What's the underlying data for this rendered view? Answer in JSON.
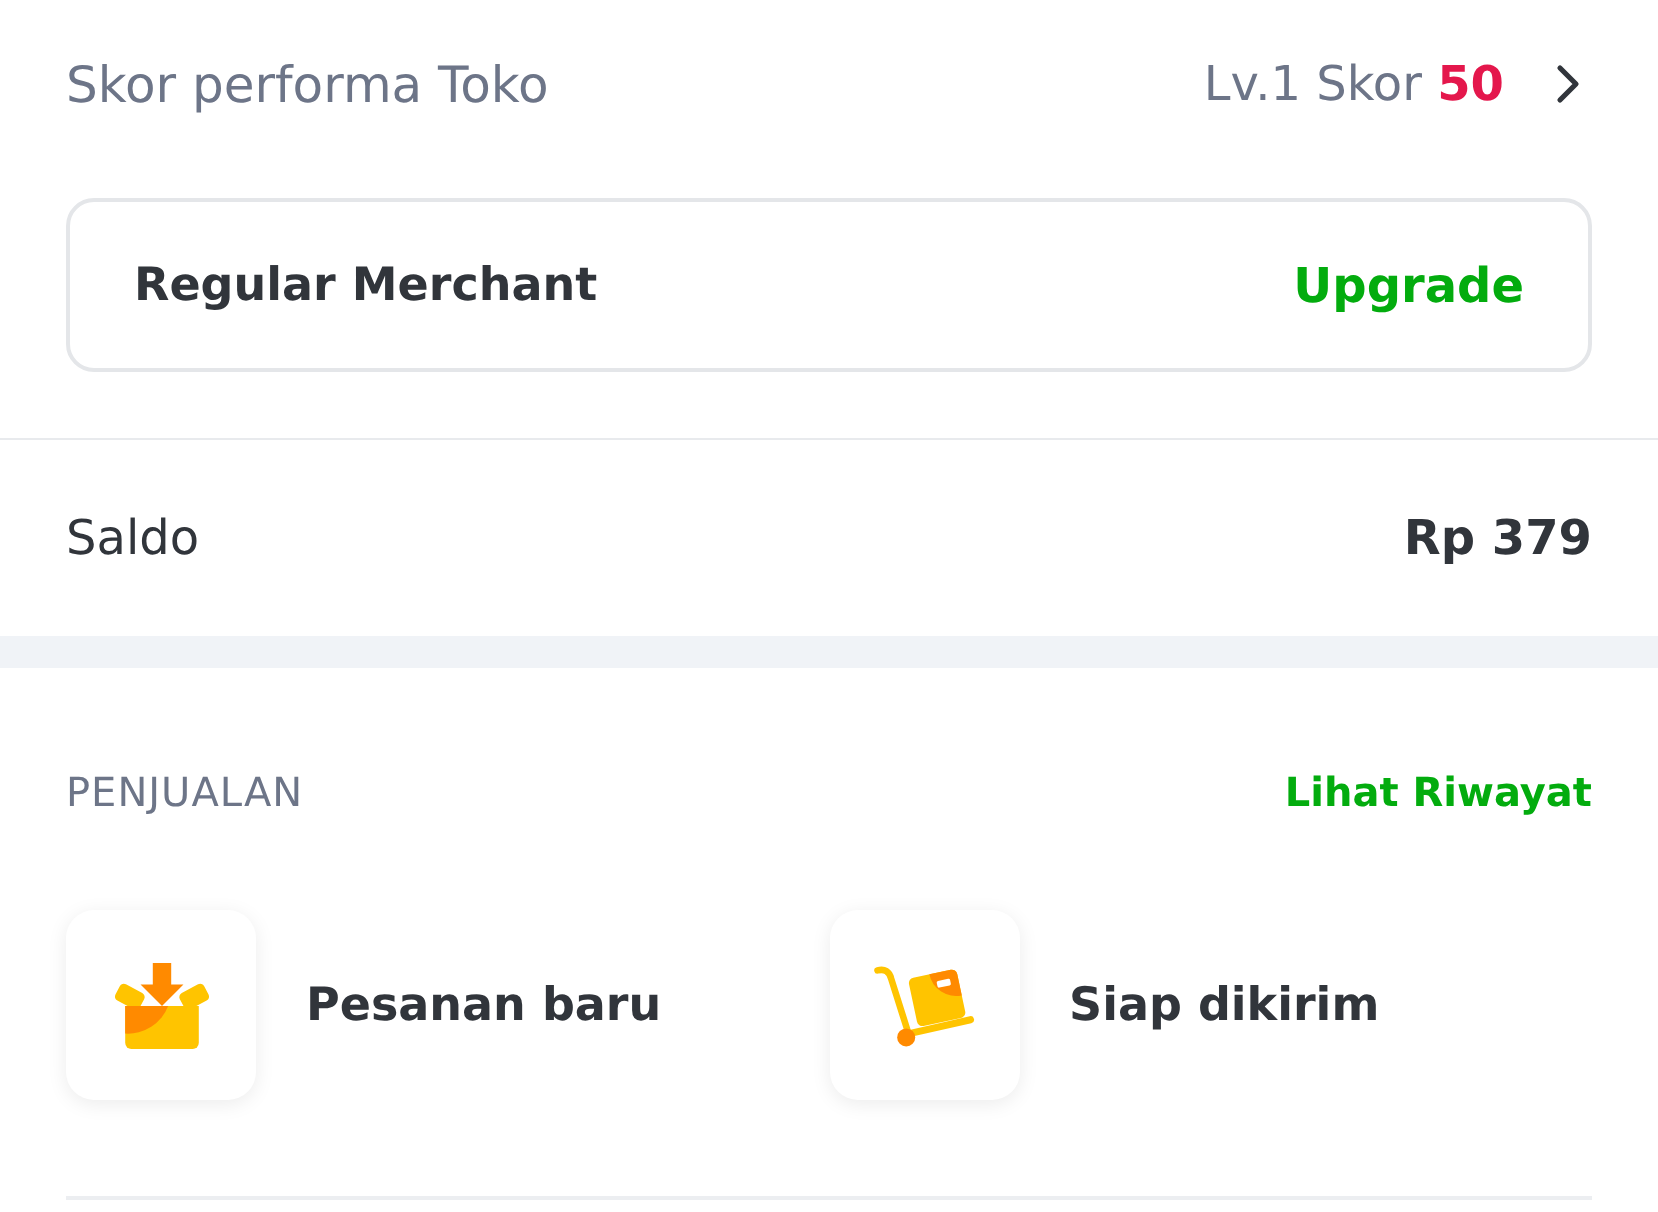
{
  "performance": {
    "label": "Skor performa Toko",
    "level_text": "Lv.1 Skor",
    "score": "50"
  },
  "merchant_card": {
    "tier": "Regular Merchant",
    "action": "Upgrade"
  },
  "balance": {
    "label": "Saldo",
    "amount": "Rp 379"
  },
  "sales": {
    "title": "PENJUALAN",
    "link": "Lihat Riwayat",
    "items": [
      {
        "kind": "new-order",
        "label": "Pesanan baru"
      },
      {
        "kind": "ready-to-ship",
        "label": "Siap dikirim"
      }
    ]
  }
}
